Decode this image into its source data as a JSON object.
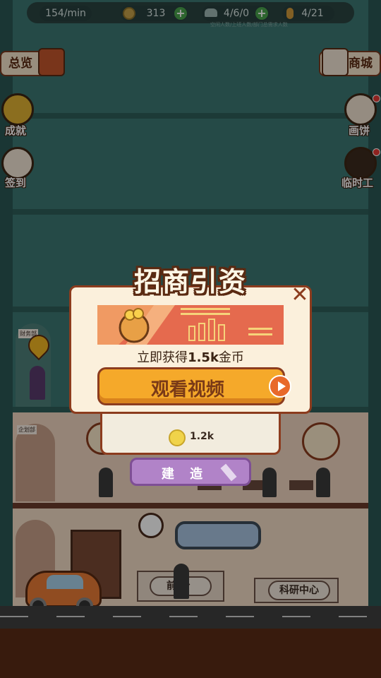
{
  "status_bar": {
    "rate": "154/min",
    "coins": "313",
    "people": "4/6/0",
    "pieces": "4/21",
    "hint": "空闲人数/上班人数/部门总需求人数"
  },
  "left_buttons": [
    {
      "label": "总览",
      "icon": "overview-book-icon"
    },
    {
      "label": "成就",
      "icon": "trophy-icon"
    },
    {
      "label": "签到",
      "icon": "lucky-cat-icon"
    }
  ],
  "right_buttons": [
    {
      "label": "商城",
      "icon": "shop-icon"
    },
    {
      "label": "画饼",
      "icon": "pie-icon"
    },
    {
      "label": "临时工",
      "icon": "hourglass-icon"
    }
  ],
  "popup": {
    "title": "招商引资",
    "reward_prefix": "立即获得",
    "reward_amount": "1.5k",
    "reward_suffix": "金币",
    "watch_button": "观看视频"
  },
  "build_panel": {
    "cost": "1.2k",
    "build_button": "建 造"
  },
  "rooms": {
    "reception": "前台",
    "research": "科研中心",
    "planning_sign": "企划部",
    "finance_sign": "财务部"
  },
  "colors": {
    "popup_border": "#8c3c1e",
    "popup_bg": "#fbf0dc",
    "watch_button": "#f5a92a",
    "build_button": "#b183c8"
  }
}
